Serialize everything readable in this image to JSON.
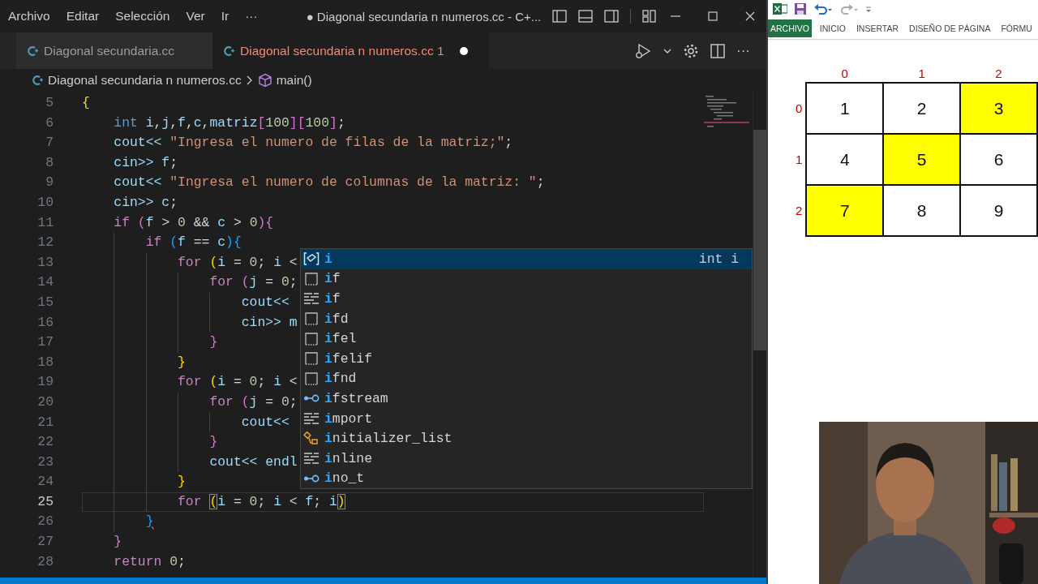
{
  "menu": [
    "Archivo",
    "Editar",
    "Selección",
    "Ver",
    "Ir",
    "···"
  ],
  "window_title": "● Diagonal secundaria n numeros.cc - C+...",
  "tabs": [
    {
      "label": "Diagonal secundaria.cc",
      "selected": false,
      "error": false,
      "modified": false
    },
    {
      "label": "Diagonal secundaria n numeros.cc",
      "problems": "1",
      "selected": true,
      "error": true,
      "modified": true
    }
  ],
  "editor_actions": {
    "more": "···"
  },
  "breadcrumbs": [
    {
      "label": "Diagonal secundaria n numeros.cc",
      "kind": "file"
    },
    {
      "label": "main()",
      "kind": "function"
    }
  ],
  "editor": {
    "lines": [
      {
        "number": "5",
        "current": false,
        "tokens": [
          {
            "kind": "bracket1",
            "text": "{"
          }
        ]
      },
      {
        "number": "6",
        "current": false,
        "tokens": [
          {
            "kind": "type",
            "text": "    int "
          },
          {
            "kind": "variable",
            "text": "i"
          },
          {
            "kind": "plain",
            "text": ","
          },
          {
            "kind": "variable",
            "text": "j"
          },
          {
            "kind": "plain",
            "text": ","
          },
          {
            "kind": "variable",
            "text": "f"
          },
          {
            "kind": "plain",
            "text": ","
          },
          {
            "kind": "variable",
            "text": "c"
          },
          {
            "kind": "plain",
            "text": ","
          },
          {
            "kind": "variable",
            "text": "matriz"
          },
          {
            "kind": "bracket2",
            "text": "["
          },
          {
            "kind": "number",
            "text": "100"
          },
          {
            "kind": "bracket2",
            "text": "]["
          },
          {
            "kind": "number",
            "text": "100"
          },
          {
            "kind": "bracket2",
            "text": "]"
          },
          {
            "kind": "plain",
            "text": ";"
          }
        ]
      },
      {
        "number": "7",
        "current": false,
        "tokens": [
          {
            "kind": "variable",
            "text": "    cout<< "
          },
          {
            "kind": "string",
            "text": "\"Ingresa el numero de filas de la matriz;\""
          },
          {
            "kind": "plain",
            "text": ";"
          }
        ]
      },
      {
        "number": "8",
        "current": false,
        "tokens": [
          {
            "kind": "variable",
            "text": "    cin>> f"
          },
          {
            "kind": "plain",
            "text": ";"
          }
        ]
      },
      {
        "number": "9",
        "current": false,
        "tokens": [
          {
            "kind": "variable",
            "text": "    cout<< "
          },
          {
            "kind": "string",
            "text": "\"Ingresa el numero de columnas de la matriz: \""
          },
          {
            "kind": "plain",
            "text": ";"
          }
        ]
      },
      {
        "number": "10",
        "current": false,
        "tokens": [
          {
            "kind": "variable",
            "text": "    cin>> c"
          },
          {
            "kind": "plain",
            "text": ";"
          }
        ]
      },
      {
        "number": "11",
        "current": false,
        "tokens": [
          {
            "kind": "keyword",
            "text": "    if "
          },
          {
            "kind": "bracket2",
            "text": "("
          },
          {
            "kind": "variable",
            "text": "f"
          },
          {
            "kind": "plain",
            "text": " > "
          },
          {
            "kind": "number",
            "text": "0"
          },
          {
            "kind": "plain",
            "text": " && "
          },
          {
            "kind": "variable",
            "text": "c"
          },
          {
            "kind": "plain",
            "text": " > "
          },
          {
            "kind": "number",
            "text": "0"
          },
          {
            "kind": "bracket2",
            "text": "){"
          }
        ]
      },
      {
        "number": "12",
        "current": false,
        "tokens": [
          {
            "kind": "keyword",
            "text": "        if "
          },
          {
            "kind": "bracket3",
            "text": "("
          },
          {
            "kind": "variable",
            "text": "f"
          },
          {
            "kind": "plain",
            "text": " == "
          },
          {
            "kind": "variable",
            "text": "c"
          },
          {
            "kind": "bracket3",
            "text": "){"
          }
        ]
      },
      {
        "number": "13",
        "current": false,
        "tokens": [
          {
            "kind": "keyword",
            "text": "            for "
          },
          {
            "kind": "bracket1",
            "text": "("
          },
          {
            "kind": "variable",
            "text": "i"
          },
          {
            "kind": "plain",
            "text": " = "
          },
          {
            "kind": "number",
            "text": "0"
          },
          {
            "kind": "plain",
            "text": "; "
          },
          {
            "kind": "variable",
            "text": "i"
          },
          {
            "kind": "plain",
            "text": " <"
          }
        ]
      },
      {
        "number": "14",
        "current": false,
        "tokens": [
          {
            "kind": "keyword",
            "text": "                for "
          },
          {
            "kind": "bracket2",
            "text": "("
          },
          {
            "kind": "variable",
            "text": "j"
          },
          {
            "kind": "plain",
            "text": " = "
          },
          {
            "kind": "number",
            "text": "0"
          },
          {
            "kind": "plain",
            "text": ";"
          }
        ]
      },
      {
        "number": "15",
        "current": false,
        "tokens": [
          {
            "kind": "variable",
            "text": "                    cout<<"
          }
        ]
      },
      {
        "number": "16",
        "current": false,
        "tokens": [
          {
            "kind": "variable",
            "text": "                    cin>> m"
          }
        ]
      },
      {
        "number": "17",
        "current": false,
        "tokens": [
          {
            "kind": "bracket2",
            "text": "                }"
          }
        ]
      },
      {
        "number": "18",
        "current": false,
        "tokens": [
          {
            "kind": "bracket1",
            "text": "            }"
          }
        ]
      },
      {
        "number": "19",
        "current": false,
        "tokens": [
          {
            "kind": "keyword",
            "text": "            for "
          },
          {
            "kind": "bracket1",
            "text": "("
          },
          {
            "kind": "variable",
            "text": "i"
          },
          {
            "kind": "plain",
            "text": " = "
          },
          {
            "kind": "number",
            "text": "0"
          },
          {
            "kind": "plain",
            "text": "; "
          },
          {
            "kind": "variable",
            "text": "i"
          },
          {
            "kind": "plain",
            "text": " <"
          }
        ]
      },
      {
        "number": "20",
        "current": false,
        "tokens": [
          {
            "kind": "keyword",
            "text": "                for "
          },
          {
            "kind": "bracket2",
            "text": "("
          },
          {
            "kind": "variable",
            "text": "j"
          },
          {
            "kind": "plain",
            "text": " = "
          },
          {
            "kind": "number",
            "text": "0"
          },
          {
            "kind": "plain",
            "text": ";"
          }
        ]
      },
      {
        "number": "21",
        "current": false,
        "tokens": [
          {
            "kind": "variable",
            "text": "                    cout<<"
          }
        ]
      },
      {
        "number": "22",
        "current": false,
        "tokens": [
          {
            "kind": "bracket2",
            "text": "                }"
          }
        ]
      },
      {
        "number": "23",
        "current": false,
        "tokens": [
          {
            "kind": "variable",
            "text": "                cout<< endl"
          }
        ]
      },
      {
        "number": "24",
        "current": false,
        "tokens": [
          {
            "kind": "bracket1",
            "text": "            }"
          }
        ]
      },
      {
        "number": "25",
        "current": true,
        "tokens": [
          {
            "kind": "keyword",
            "text": "            for "
          },
          {
            "kind": "bracket1_match",
            "text": "("
          },
          {
            "kind": "variable",
            "text": "i"
          },
          {
            "kind": "plain",
            "text": " = "
          },
          {
            "kind": "number",
            "text": "0"
          },
          {
            "kind": "plain",
            "text": "; "
          },
          {
            "kind": "variable",
            "text": "i"
          },
          {
            "kind": "plain",
            "text": " < "
          },
          {
            "kind": "variable",
            "text": "f"
          },
          {
            "kind": "plain",
            "text": "; "
          },
          {
            "kind": "variable",
            "text": "i"
          },
          {
            "kind": "bracket1_match",
            "text": ")"
          }
        ]
      },
      {
        "number": "26",
        "current": false,
        "tokens": [
          {
            "kind": "bracket3_error",
            "text": "        }"
          }
        ]
      },
      {
        "number": "27",
        "current": false,
        "tokens": [
          {
            "kind": "bracket2",
            "text": "    }"
          }
        ]
      },
      {
        "number": "28",
        "current": false,
        "tokens": [
          {
            "kind": "keyword",
            "text": "    return "
          },
          {
            "kind": "number",
            "text": "0"
          },
          {
            "kind": "plain",
            "text": ";"
          }
        ]
      }
    ]
  },
  "suggestions": [
    {
      "kind": "variable",
      "match": "i",
      "selected": true,
      "detail": "int i"
    },
    {
      "kind": "snippet",
      "match": "i",
      "rest": "f",
      "selected": false
    },
    {
      "kind": "keyword",
      "match": "i",
      "rest": "f",
      "selected": false
    },
    {
      "kind": "snippet",
      "match": "i",
      "rest": "fd",
      "selected": false
    },
    {
      "kind": "snippet",
      "match": "i",
      "rest": "fel",
      "selected": false
    },
    {
      "kind": "snippet",
      "match": "i",
      "rest": "felif",
      "selected": false
    },
    {
      "kind": "snippet",
      "match": "i",
      "rest": "fnd",
      "selected": false
    },
    {
      "kind": "interface",
      "match": "i",
      "rest": "fstream",
      "selected": false
    },
    {
      "kind": "keyword",
      "match": "i",
      "rest": "mport",
      "selected": false
    },
    {
      "kind": "class",
      "match": "i",
      "rest": "nitializer_list",
      "selected": false
    },
    {
      "kind": "keyword",
      "match": "i",
      "rest": "nline",
      "selected": false
    },
    {
      "kind": "interface",
      "match": "i",
      "rest": "no_t",
      "selected": false
    }
  ],
  "excel": {
    "tabs": [
      {
        "label": "ARCHIVO",
        "selected": true
      },
      {
        "label": "INICIO",
        "selected": false
      },
      {
        "label": "INSERTAR",
        "selected": false
      },
      {
        "label": "DISEÑO DE PÁGINA",
        "selected": false
      },
      {
        "label": "FÓRMU",
        "selected": false
      }
    ],
    "sheet": {
      "column_headers": [
        "0",
        "1",
        "2"
      ],
      "rows": [
        {
          "header": "0",
          "cells": [
            {
              "value": "1",
              "highlighted": false
            },
            {
              "value": "2",
              "highlighted": false
            },
            {
              "value": "3",
              "highlighted": true
            }
          ]
        },
        {
          "header": "1",
          "cells": [
            {
              "value": "4",
              "highlighted": false
            },
            {
              "value": "5",
              "highlighted": true
            },
            {
              "value": "6",
              "highlighted": false
            }
          ]
        },
        {
          "header": "2",
          "cells": [
            {
              "value": "7",
              "highlighted": true
            },
            {
              "value": "8",
              "highlighted": false
            },
            {
              "value": "9",
              "highlighted": false
            }
          ]
        }
      ]
    }
  }
}
